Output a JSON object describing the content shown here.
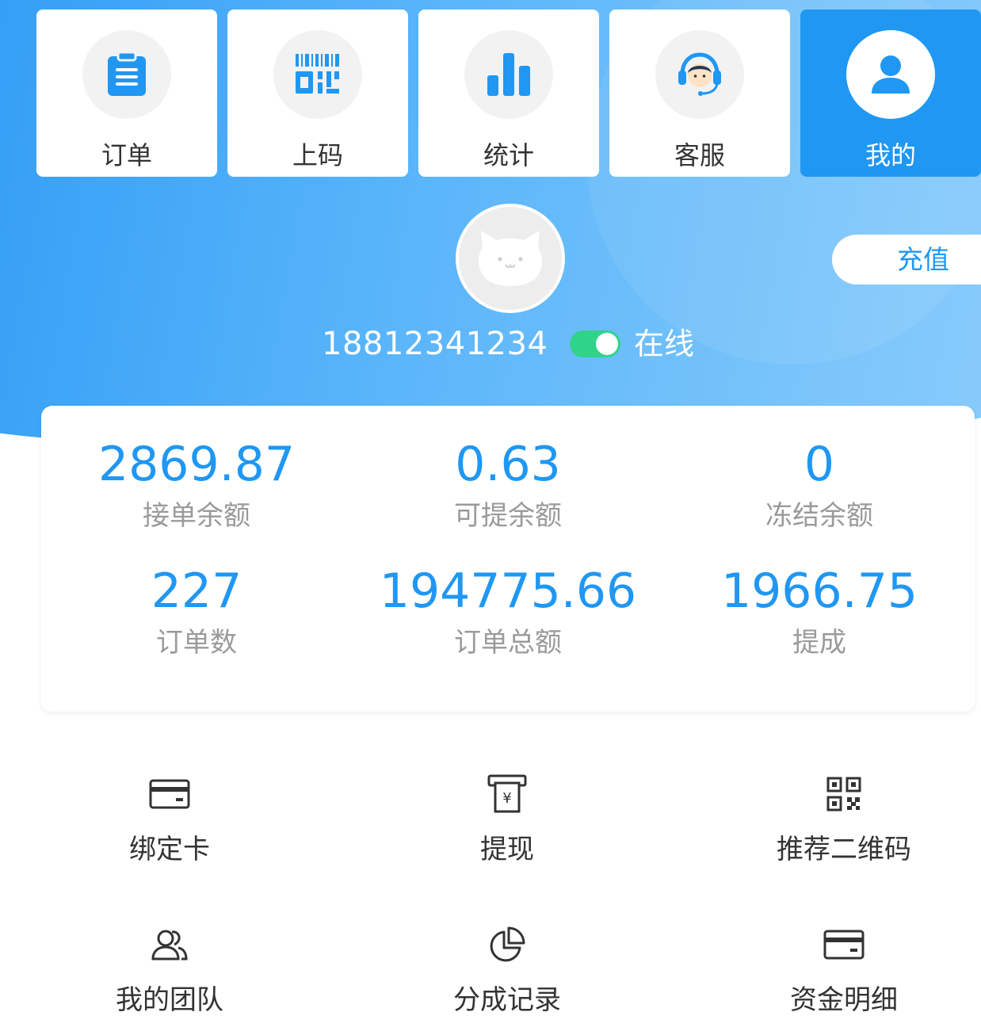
{
  "nav": {
    "items": [
      {
        "label": "订单",
        "icon": "clipboard-icon",
        "active": false
      },
      {
        "label": "上码",
        "icon": "barcode-icon",
        "active": false
      },
      {
        "label": "统计",
        "icon": "bar-chart-icon",
        "active": false
      },
      {
        "label": "客服",
        "icon": "headset-agent-icon",
        "active": false
      },
      {
        "label": "我的",
        "icon": "user-icon",
        "active": true
      }
    ]
  },
  "profile": {
    "phone": "18812341234",
    "status_label": "在线",
    "online": true,
    "recharge_label": "充值",
    "avatar_icon": "cat-avatar-icon"
  },
  "stats": [
    {
      "value": "2869.87",
      "label": "接单余额"
    },
    {
      "value": "0.63",
      "label": "可提余额"
    },
    {
      "value": "0",
      "label": "冻结余额"
    },
    {
      "value": "227",
      "label": "订单数"
    },
    {
      "value": "194775.66",
      "label": "订单总额"
    },
    {
      "value": "1966.75",
      "label": "提成"
    }
  ],
  "menu": [
    {
      "label": "绑定卡",
      "icon": "card-icon"
    },
    {
      "label": "提现",
      "icon": "withdraw-icon"
    },
    {
      "label": "推荐二维码",
      "icon": "qr-code-icon"
    },
    {
      "label": "我的团队",
      "icon": "team-icon"
    },
    {
      "label": "分成记录",
      "icon": "pie-chart-icon"
    },
    {
      "label": "资金明细",
      "icon": "wallet-card-icon"
    }
  ],
  "colors": {
    "accent": "#1f97f3",
    "online": "#2fd48a",
    "label_gray": "#9a9a9a",
    "text_dark": "#333333"
  }
}
